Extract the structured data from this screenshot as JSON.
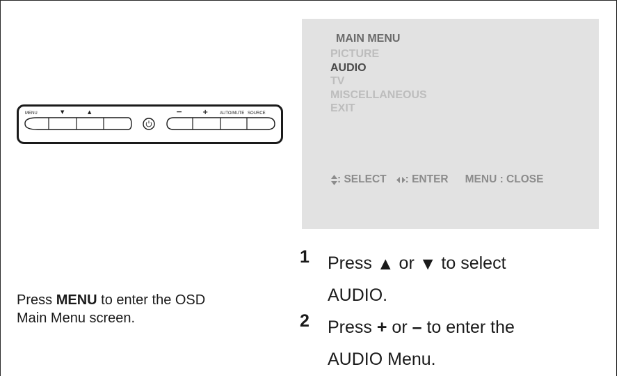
{
  "remote": {
    "menu_label": "MENU",
    "down_label": "▼",
    "up_label": "▲",
    "power_icon": "power-icon",
    "minus_label": "−",
    "plus_label": "+",
    "automute_label": "AUTO/MUTE",
    "source_label": "SOURCE"
  },
  "osd": {
    "title": "MAIN MENU",
    "items": [
      {
        "label": "PICTURE",
        "selected": false
      },
      {
        "label": "AUDIO",
        "selected": true
      },
      {
        "label": "TV",
        "selected": false
      },
      {
        "label": "MISCELLANEOUS",
        "selected": false
      },
      {
        "label": "EXIT",
        "selected": false
      }
    ],
    "hints": {
      "select_label": ": SELECT",
      "enter_label": ": ENTER",
      "close_label": "MENU : CLOSE"
    },
    "colors": {
      "background": "#e2e2e2",
      "selected": "#4a4a4a",
      "unselected": "#bdbdbd"
    }
  },
  "description": {
    "prefix": "Press ",
    "key": "MENU",
    "suffix": " to enter the OSD",
    "line2": "Main Menu screen."
  },
  "steps": [
    {
      "number": "1",
      "line1_prefix": "Press ",
      "line1_up": "▲",
      "line1_mid": " or ",
      "line1_down": "▼",
      "line1_suffix": " to select",
      "line2": "AUDIO."
    },
    {
      "number": "2",
      "line1_prefix": "Press ",
      "line1_plus": "+",
      "line1_mid": " or ",
      "line1_minus": "–",
      "line1_suffix": " to enter the",
      "line2": "AUDIO Menu."
    }
  ]
}
